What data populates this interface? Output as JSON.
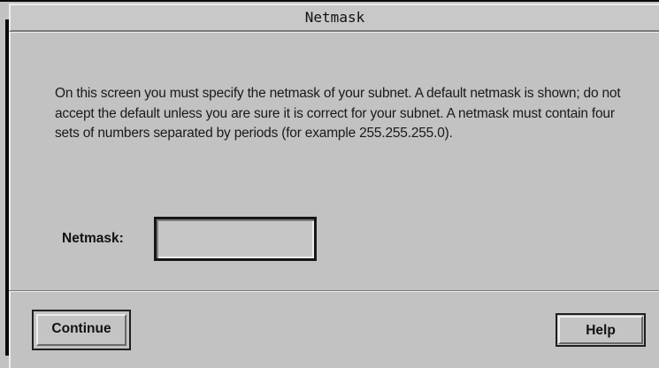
{
  "window": {
    "title": "Netmask"
  },
  "content": {
    "description": "On this screen you must specify the netmask of your subnet.  A default netmask is shown; do not accept the default unless you are sure it is correct for your subnet.  A netmask must contain four sets of numbers separated by periods (for example 255.255.255.0).",
    "netmask_label": "Netmask:",
    "netmask_value": ""
  },
  "buttons": {
    "continue_label": "Continue",
    "help_label": "Help"
  }
}
